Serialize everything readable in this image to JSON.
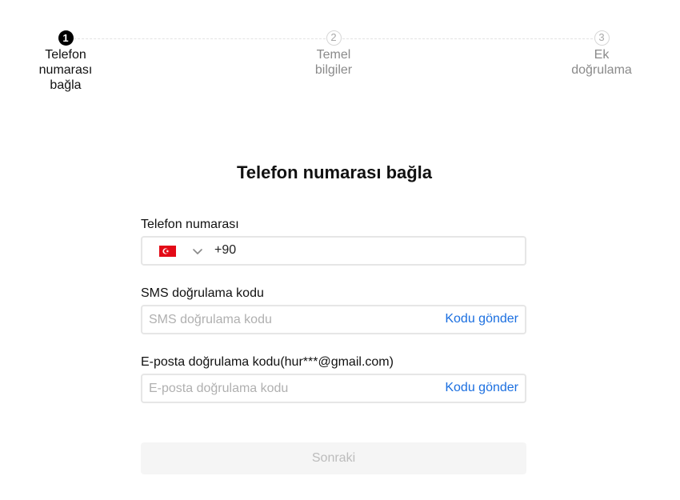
{
  "stepper": {
    "steps": [
      {
        "number": "1",
        "label": "Telefon numarası bağla",
        "state": "active"
      },
      {
        "number": "2",
        "label": "Temel bilgiler",
        "state": "inactive"
      },
      {
        "number": "3",
        "label": "Ek doğrulama",
        "state": "inactive"
      }
    ]
  },
  "form": {
    "title": "Telefon numarası bağla",
    "phone": {
      "label": "Telefon numarası",
      "country_flag": "turkey-flag-icon",
      "country_code": "+90",
      "value": ""
    },
    "sms": {
      "label": "SMS doğrulama kodu",
      "placeholder": "SMS doğrulama kodu",
      "send_label": "Kodu gönder"
    },
    "email": {
      "label": "E-posta doğrulama kodu(hur***@gmail.com)",
      "placeholder": "E-posta doğrulama kodu",
      "send_label": "Kodu gönder"
    },
    "next_label": "Sonraki"
  },
  "colors": {
    "link": "#1b6fe0",
    "active_step": "#000000",
    "disabled_button_bg": "#f5f5f5",
    "flag_red": "#e30a17"
  }
}
